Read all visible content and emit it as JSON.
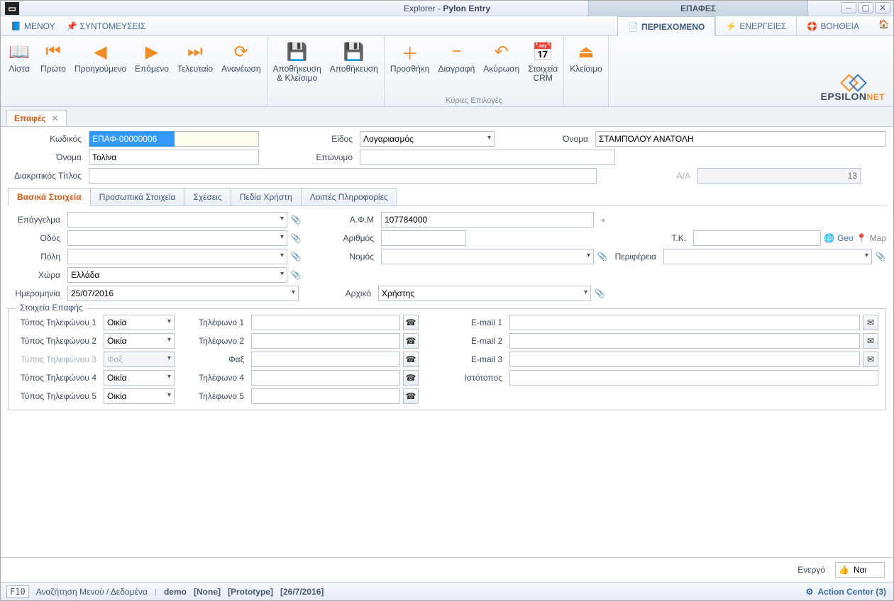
{
  "title": {
    "prefix": "Explorer - ",
    "app": "Pylon Entry",
    "context": "ΕΠΑΦΕΣ"
  },
  "menu": {
    "menu": "ΜΕΝΟΥ",
    "shortcuts": "ΣΥΝΤΟΜΕΥΣΕΙΣ"
  },
  "rtabs": {
    "content": "ΠΕΡΙΕΧΟΜΕΝΟ",
    "actions": "ΕΝΕΡΓΕΙΕΣ",
    "help": "ΒΟΗΘΕΙΑ"
  },
  "ribbon": {
    "list": "Λίστα",
    "first": "Πρώτο",
    "prev": "Προηγούμενο",
    "next": "Επόμενο",
    "last": "Τελευταίο",
    "refresh": "Ανανέωση",
    "save_close": "Αποθήκευση\n& Κλείσιμο",
    "save": "Αποθήκευση",
    "add": "Προσθήκη",
    "delete": "Διαγραφή",
    "cancel": "Ακύρωση",
    "crm": "Στοιχεία\nCRM",
    "close": "Κλείσιμο",
    "group_label": "Κύριες Επιλογές"
  },
  "brand": "EPSILONNET",
  "doctab": "Επαφές",
  "form": {
    "labels": {
      "code": "Κωδικός",
      "kind": "Είδος",
      "name": "Όνομα",
      "first_name": "Όνομα",
      "last_name": "Επώνυμο",
      "trade_title": "Διακριτικός Τίτλος",
      "aa": "Α/Α",
      "profession": "Επάγγελμα",
      "afm": "Α.Φ.Μ",
      "street": "Οδός",
      "streetno": "Αριθμός",
      "zip": "Τ.Κ.",
      "city": "Πόλη",
      "prefecture": "Νομός",
      "region": "Περιφέρεια",
      "country": "Χώρα",
      "date": "Ημερομηνία",
      "origin": "Αρχικό",
      "geo": "Geo",
      "map": "Map",
      "contact_section": "Στοιχεία Επαφής",
      "phone_type": [
        "Τύπος Τηλεφώνου 1",
        "Τύπος Τηλεφώνου 2",
        "Τύπος Τηλεφώνου 3",
        "Τύπος Τηλεφώνου 4",
        "Τύπος Τηλεφώνου 5"
      ],
      "phone": [
        "Τηλέφωνο 1",
        "Τηλέφωνο 2",
        "Φαξ",
        "Τηλέφωνο 4",
        "Τηλέφωνο 5"
      ],
      "email": [
        "E-mail 1",
        "E-mail 2",
        "E-mail 3"
      ],
      "website": "Ιστότοπος",
      "active": "Ενεργό",
      "yes": "Ναι"
    },
    "values": {
      "code": "ΕΠΑΦ-00000006",
      "kind": "Λογαριασμός",
      "name": "ΣΤΑΜΠΟΛΟΥ ΑΝΑΤΟΛΗ",
      "first_name": "Τολίνα",
      "last_name": "",
      "trade_title": "",
      "aa": "13",
      "afm": "107784000",
      "country": "Ελλάδα",
      "date": "25/07/2016",
      "origin": "Χρήστης",
      "phone_type": [
        "Οικία",
        "Οικία",
        "Φαξ",
        "Οικία",
        "Οικία"
      ]
    },
    "subtabs": [
      "Βασικά Στοιχεία",
      "Προσωπικά Στοιχεία",
      "Σχέσεις",
      "Πεδία Χρήστη",
      "Λοιπές Πληροφορίες"
    ]
  },
  "status": {
    "key": "F10",
    "search": "Αναζήτηση Μενού / Δεδομένα",
    "db": "demo",
    "user": "[None]",
    "env": "[Prototype]",
    "date": "[26/7/2016]",
    "action_center": "Action Center (3)"
  }
}
